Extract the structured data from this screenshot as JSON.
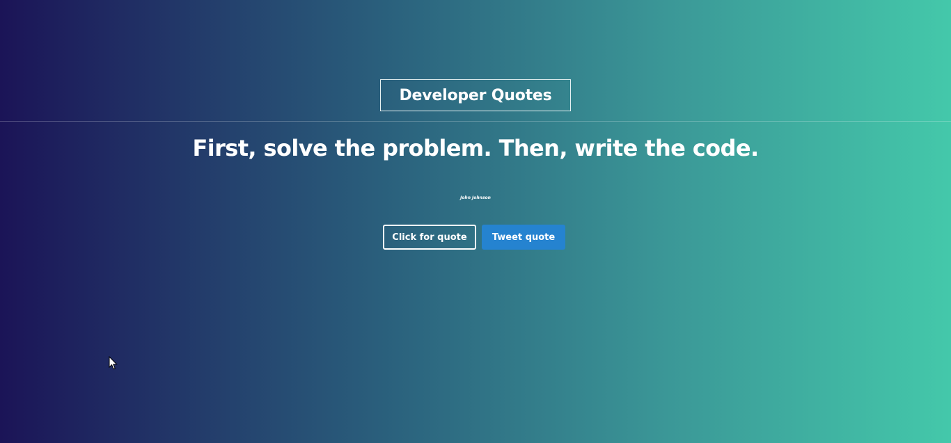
{
  "header": {
    "title": "Developer Quotes"
  },
  "quote": {
    "text": "First, solve the problem. Then, write the code.",
    "author": "John Johnson"
  },
  "actions": {
    "new_quote_label": "Click for quote",
    "tweet_label": "Tweet quote"
  },
  "colors": {
    "gradient_start": "#1b1457",
    "gradient_end": "#44c8aa",
    "tweet_button": "#2583d0"
  },
  "icons": {
    "cursor": "mouse-pointer-icon"
  }
}
